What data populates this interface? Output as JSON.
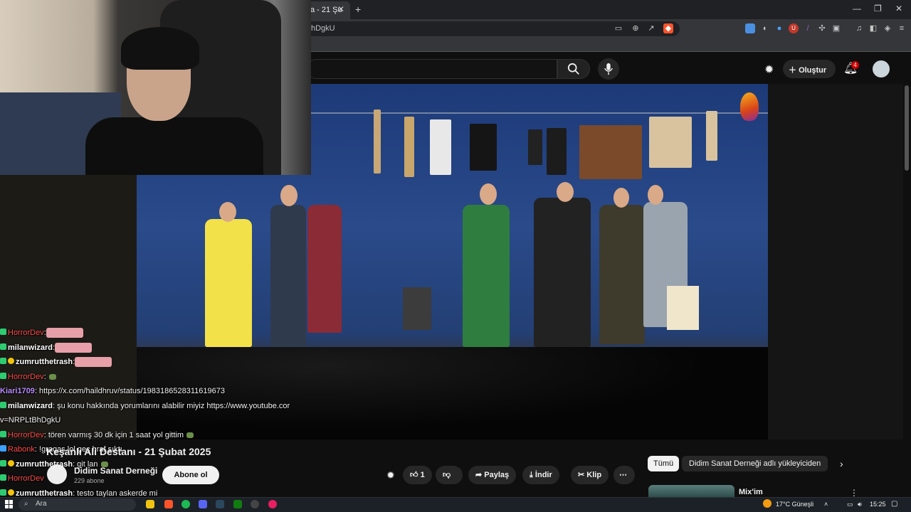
{
  "browser": {
    "tab_title": "a - 21 Şu",
    "tab_close": "✕",
    "new_tab": "+",
    "url_fragment": "hDgkU",
    "window_controls": [
      "—",
      "❐",
      "✕"
    ],
    "extension_badge": "U"
  },
  "youtube": {
    "create_label": "Oluştur",
    "notification_count": "4",
    "video_title": "Keşanlı Ali Destanı - 21 Şubat 2025",
    "channel_name": "Didim Sanat Derneği",
    "channel_subs": "229 abone",
    "subscribe_label": "Abone ol",
    "like_count": "1",
    "share_label": "Paylaş",
    "download_label": "İndir",
    "clip_label": "Klip",
    "chips": {
      "all": "Tümü",
      "uploader": "Didim Sanat Derneği adlı yükleyiciden"
    },
    "recommended_title": "Mix'im"
  },
  "chat": [
    {
      "user": "HorrorDev",
      "user_class": "u-red",
      "badge": "green",
      "text": ":",
      "emote": true
    },
    {
      "user": "milanwizard",
      "user_class": "u-wh",
      "badge": "green",
      "text": ":",
      "emote": true
    },
    {
      "user": "zumrutthetrash",
      "user_class": "u-wh",
      "badge": "gold",
      "text": ":",
      "emote": true
    },
    {
      "user": "HorrorDev",
      "user_class": "u-red",
      "badge": "green",
      "text": ":",
      "gem": true
    },
    {
      "user": "Kiari1709",
      "user_class": "u-pur",
      "badge": "none",
      "text": ": https://x.com/haildhruv/status/1983186528311619673"
    },
    {
      "user": "milanwizard",
      "user_class": "u-wh",
      "badge": "green",
      "text": ": şu konu hakkında yorumlarını alabilir miyiz https://www.youtube.cor"
    },
    {
      "user": "",
      "user_class": "",
      "badge": "none",
      "text": "v=NRPLtBhDgkU"
    },
    {
      "user": "HorrorDev",
      "user_class": "u-red",
      "badge": "green",
      "text": ": tören varmış 30 dk için 1 saat yol gittim",
      "gem": true
    },
    {
      "user": "Rabonk",
      "user_class": "u-red",
      "badge": "blue",
      "text": ": !graqas lol geç hraf sıktı"
    },
    {
      "user": "zumrutthetrash",
      "user_class": "u-wh",
      "badge": "gold",
      "text": ": git lan",
      "gem": true
    },
    {
      "user": "HorrorDev",
      "user_class": "u-red",
      "badge": "green",
      "text": ""
    },
    {
      "user": "zumrutthetrash",
      "user_class": "u-wh",
      "badge": "gold",
      "text": ": testo taylan askerde mi"
    }
  ],
  "taskbar": {
    "search_placeholder": "Ara",
    "weather": "17°C  Güneşli",
    "time": "15:25"
  },
  "colors": {
    "youtube_bg": "#0f0f0f",
    "stage_blue": "#2a4a8a",
    "notification_red": "#cc0000"
  }
}
